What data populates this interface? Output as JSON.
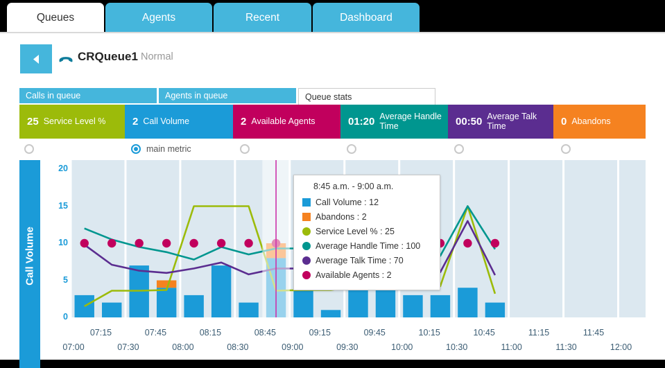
{
  "tabs": [
    {
      "label": "Queues",
      "active": true
    },
    {
      "label": "Agents",
      "active": false
    },
    {
      "label": "Recent",
      "active": false
    },
    {
      "label": "Dashboard",
      "active": false
    }
  ],
  "header": {
    "back_icon": "back-arrow-icon",
    "phone_icon": "phone-handset-icon",
    "queue_name": "CRQueue1",
    "queue_status": "Normal"
  },
  "subtabs": [
    {
      "label": "Calls in queue",
      "active": false
    },
    {
      "label": "Agents in queue",
      "active": false
    },
    {
      "label": "Queue stats",
      "active": true
    }
  ],
  "metrics": [
    {
      "value": "25",
      "label": "Service Level %",
      "color": "#9cbb0a",
      "width": 152,
      "selected": false
    },
    {
      "value": "2",
      "label": "Call Volume",
      "color": "#1b9bd8",
      "width": 156,
      "selected": true,
      "radio_label": "main metric"
    },
    {
      "value": "2",
      "label": "Available Agents",
      "color": "#c1005d",
      "width": 155,
      "selected": false
    },
    {
      "value": "01:20",
      "label": "Average Handle Time",
      "color": "#00968f",
      "width": 155,
      "selected": false
    },
    {
      "value": "00:50",
      "label": "Average Talk Time",
      "color": "#5b2d90",
      "width": 152,
      "selected": false
    },
    {
      "value": "0",
      "label": "Abandons",
      "color": "#f58220",
      "width": 133,
      "selected": false
    }
  ],
  "tooltip": {
    "time_range": "8:45 a.m. - 9:00 a.m.",
    "rows": [
      {
        "name": "Call Volume",
        "value": "12",
        "color": "#1b9bd8",
        "shape": "square"
      },
      {
        "name": "Abandons",
        "value": "2",
        "color": "#f58220",
        "shape": "square"
      },
      {
        "name": "Service Level %",
        "value": "25",
        "color": "#9cbb0a",
        "shape": "circle"
      },
      {
        "name": "Average Handle Time",
        "value": "100",
        "color": "#00968f",
        "shape": "circle"
      },
      {
        "name": "Average Talk Time",
        "value": "70",
        "color": "#5b2d90",
        "shape": "circle"
      },
      {
        "name": "Available Agents",
        "value": "2",
        "color": "#c1005d",
        "shape": "circle"
      }
    ]
  },
  "chart_data": {
    "type": "bar",
    "title": "",
    "xlabel": "",
    "ylabel": "Call Volume",
    "ylim": [
      0,
      20
    ],
    "yticks": [
      0,
      5,
      10,
      15,
      20
    ],
    "grid": true,
    "legend_position": "tooltip",
    "plot_background": "#dce8f0",
    "highlight_category": "08:45",
    "categories": [
      "07:00",
      "07:15",
      "07:30",
      "07:45",
      "08:00",
      "08:15",
      "08:30",
      "08:45",
      "09:00",
      "09:15",
      "09:30",
      "09:45",
      "10:00",
      "10:15",
      "10:30",
      "10:45",
      "11:00",
      "11:15",
      "11:30",
      "11:45",
      "12:00"
    ],
    "series": [
      {
        "name": "Call Volume",
        "type": "bar",
        "color": "#1b9bd8",
        "values": [
          3,
          2,
          7,
          5,
          3,
          7,
          2,
          10,
          9,
          1,
          6,
          5,
          3,
          3,
          4,
          2,
          null,
          null,
          null,
          null,
          null
        ]
      },
      {
        "name": "Abandons",
        "type": "bar-stack",
        "color": "#f58220",
        "values": [
          0,
          0,
          0,
          1,
          0,
          0,
          0,
          2,
          0,
          0,
          1,
          0,
          0,
          0,
          0,
          0,
          null,
          null,
          null,
          null,
          null
        ]
      },
      {
        "name": "Service Level %",
        "type": "line",
        "color": "#9cbb0a",
        "scale": "secondary",
        "values": [
          1.5,
          3.6,
          3.6,
          3.7,
          15,
          15,
          15,
          3.6,
          3.7,
          3.7,
          4.2,
          4.2,
          4.2,
          4.2,
          15,
          3.2,
          null,
          null,
          null,
          null,
          null
        ]
      },
      {
        "name": "Average Handle Time",
        "type": "line",
        "color": "#00968f",
        "scale": "secondary",
        "values": [
          12,
          10.5,
          9.5,
          8.8,
          7.8,
          9.5,
          8.5,
          9.3,
          9.3,
          9.3,
          9.3,
          8.3,
          8.3,
          8.3,
          15,
          9.2,
          null,
          null,
          null,
          null,
          null
        ]
      },
      {
        "name": "Average Talk Time",
        "type": "line",
        "color": "#5b2d90",
        "scale": "secondary",
        "values": [
          9.8,
          7.1,
          6.3,
          6,
          6.6,
          7.4,
          5.8,
          6.6,
          6.6,
          7.1,
          6.1,
          6.1,
          6.1,
          6.1,
          13,
          5.7,
          null,
          null,
          null,
          null,
          null
        ]
      },
      {
        "name": "Available Agents",
        "type": "scatter",
        "color": "#c1005d",
        "scale": "secondary",
        "values": [
          10,
          10,
          10,
          10,
          10,
          10,
          10,
          10,
          10,
          10,
          10,
          10,
          10,
          10,
          10,
          10,
          null,
          null,
          null,
          null,
          null
        ]
      }
    ]
  }
}
